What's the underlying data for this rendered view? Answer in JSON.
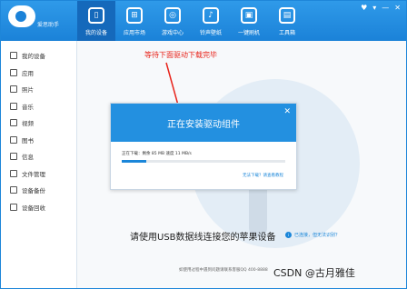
{
  "app": {
    "logo_text": "爱思助手",
    "window_controls": [
      "♥",
      "▾",
      "—",
      "✕"
    ]
  },
  "nav": [
    {
      "label": "我的设备",
      "icon": "phone-icon",
      "glyph": "▯",
      "active": true
    },
    {
      "label": "应用市场",
      "icon": "apps-icon",
      "glyph": "⊞",
      "active": false
    },
    {
      "label": "游戏中心",
      "icon": "gamepad-icon",
      "glyph": "◎",
      "active": false
    },
    {
      "label": "铃声壁纸",
      "icon": "music-icon",
      "glyph": "♪",
      "active": false
    },
    {
      "label": "一键刷机",
      "icon": "flash-icon",
      "glyph": "▣",
      "active": false
    },
    {
      "label": "工具箱",
      "icon": "toolbox-icon",
      "glyph": "▤",
      "active": false
    }
  ],
  "sidebar": [
    {
      "label": "我的设备",
      "icon": "device-icon"
    },
    {
      "label": "应用",
      "icon": "apps-icon"
    },
    {
      "label": "照片",
      "icon": "photo-icon"
    },
    {
      "label": "音乐",
      "icon": "music-icon"
    },
    {
      "label": "视频",
      "icon": "video-icon"
    },
    {
      "label": "图书",
      "icon": "book-icon"
    },
    {
      "label": "信息",
      "icon": "message-icon"
    },
    {
      "label": "文件管理",
      "icon": "folder-icon"
    },
    {
      "label": "设备备份",
      "icon": "backup-icon"
    },
    {
      "label": "设备回收",
      "icon": "recycle-icon"
    }
  ],
  "annotation": "等待下面驱动下载完毕",
  "dialog": {
    "title": "正在安装驱动组件",
    "close": "✕",
    "progress_text": "正在下载：剩余 85 MB 速度 11 MB/s",
    "progress": 0.15,
    "link": "无法下载？请查看教程"
  },
  "main": {
    "prompt": "请使用USB数据线连接您的苹果设备",
    "connected_link": "已连接，但无法识别？",
    "info_glyph": "i",
    "footer": "如使用过程中遇到问题请联系客服QQ 400-8888"
  },
  "watermark": "CSDN @古月雅佳"
}
